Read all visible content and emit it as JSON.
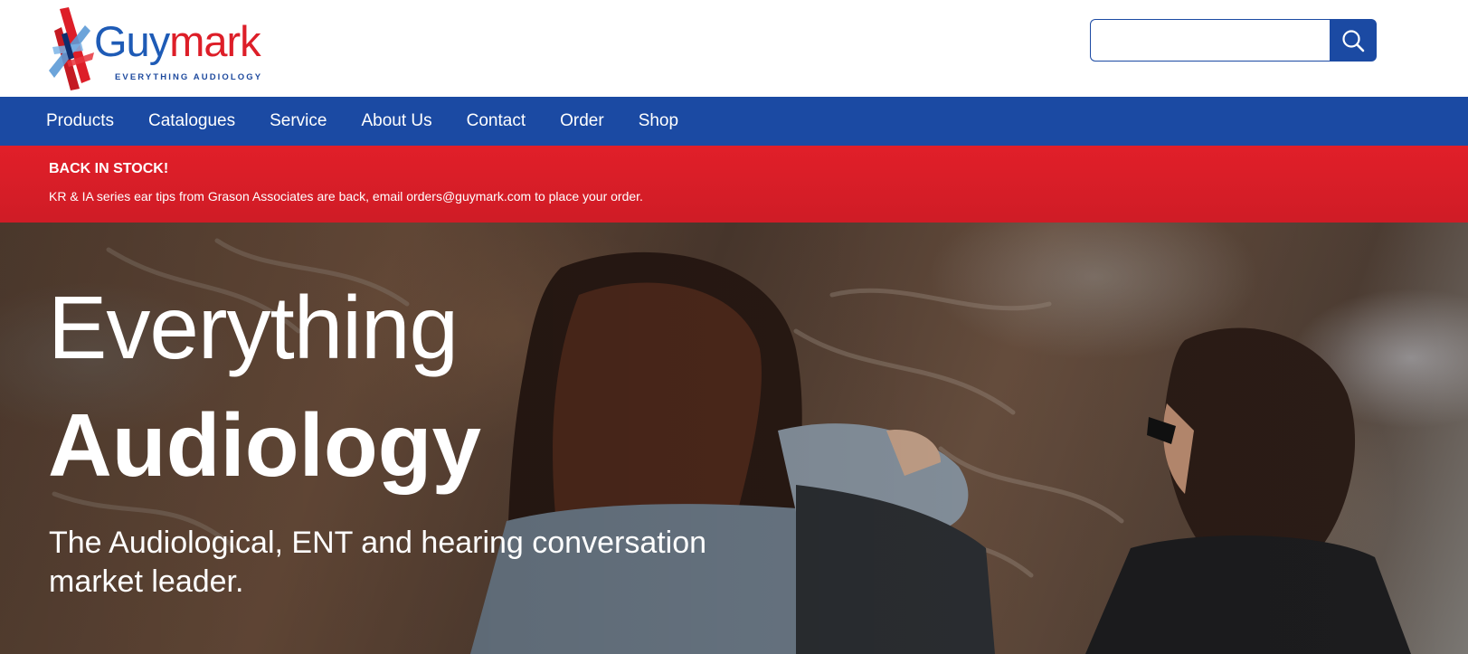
{
  "header": {
    "logo": {
      "name_part1": "Guy",
      "name_part2": "mark",
      "tagline": "EVERYTHING AUDIOLOGY"
    },
    "search": {
      "placeholder": "",
      "value": "",
      "button_icon": "search-icon"
    }
  },
  "nav": {
    "items": [
      {
        "label": "Products"
      },
      {
        "label": "Catalogues"
      },
      {
        "label": "Service"
      },
      {
        "label": "About Us"
      },
      {
        "label": "Contact"
      },
      {
        "label": "Order"
      },
      {
        "label": "Shop"
      }
    ]
  },
  "alert": {
    "title": "BACK IN STOCK!",
    "text": "KR & IA series ear tips from Grason Associates are back, email orders@guymark.com to place your order."
  },
  "hero": {
    "line1": "Everything",
    "line2": "Audiology",
    "subtitle": "The Audiological, ENT and hearing conversation market leader."
  },
  "colors": {
    "brand_blue": "#1b4aa3",
    "brand_red": "#dd1e28",
    "alert_red": "#e11f29",
    "white": "#ffffff"
  }
}
